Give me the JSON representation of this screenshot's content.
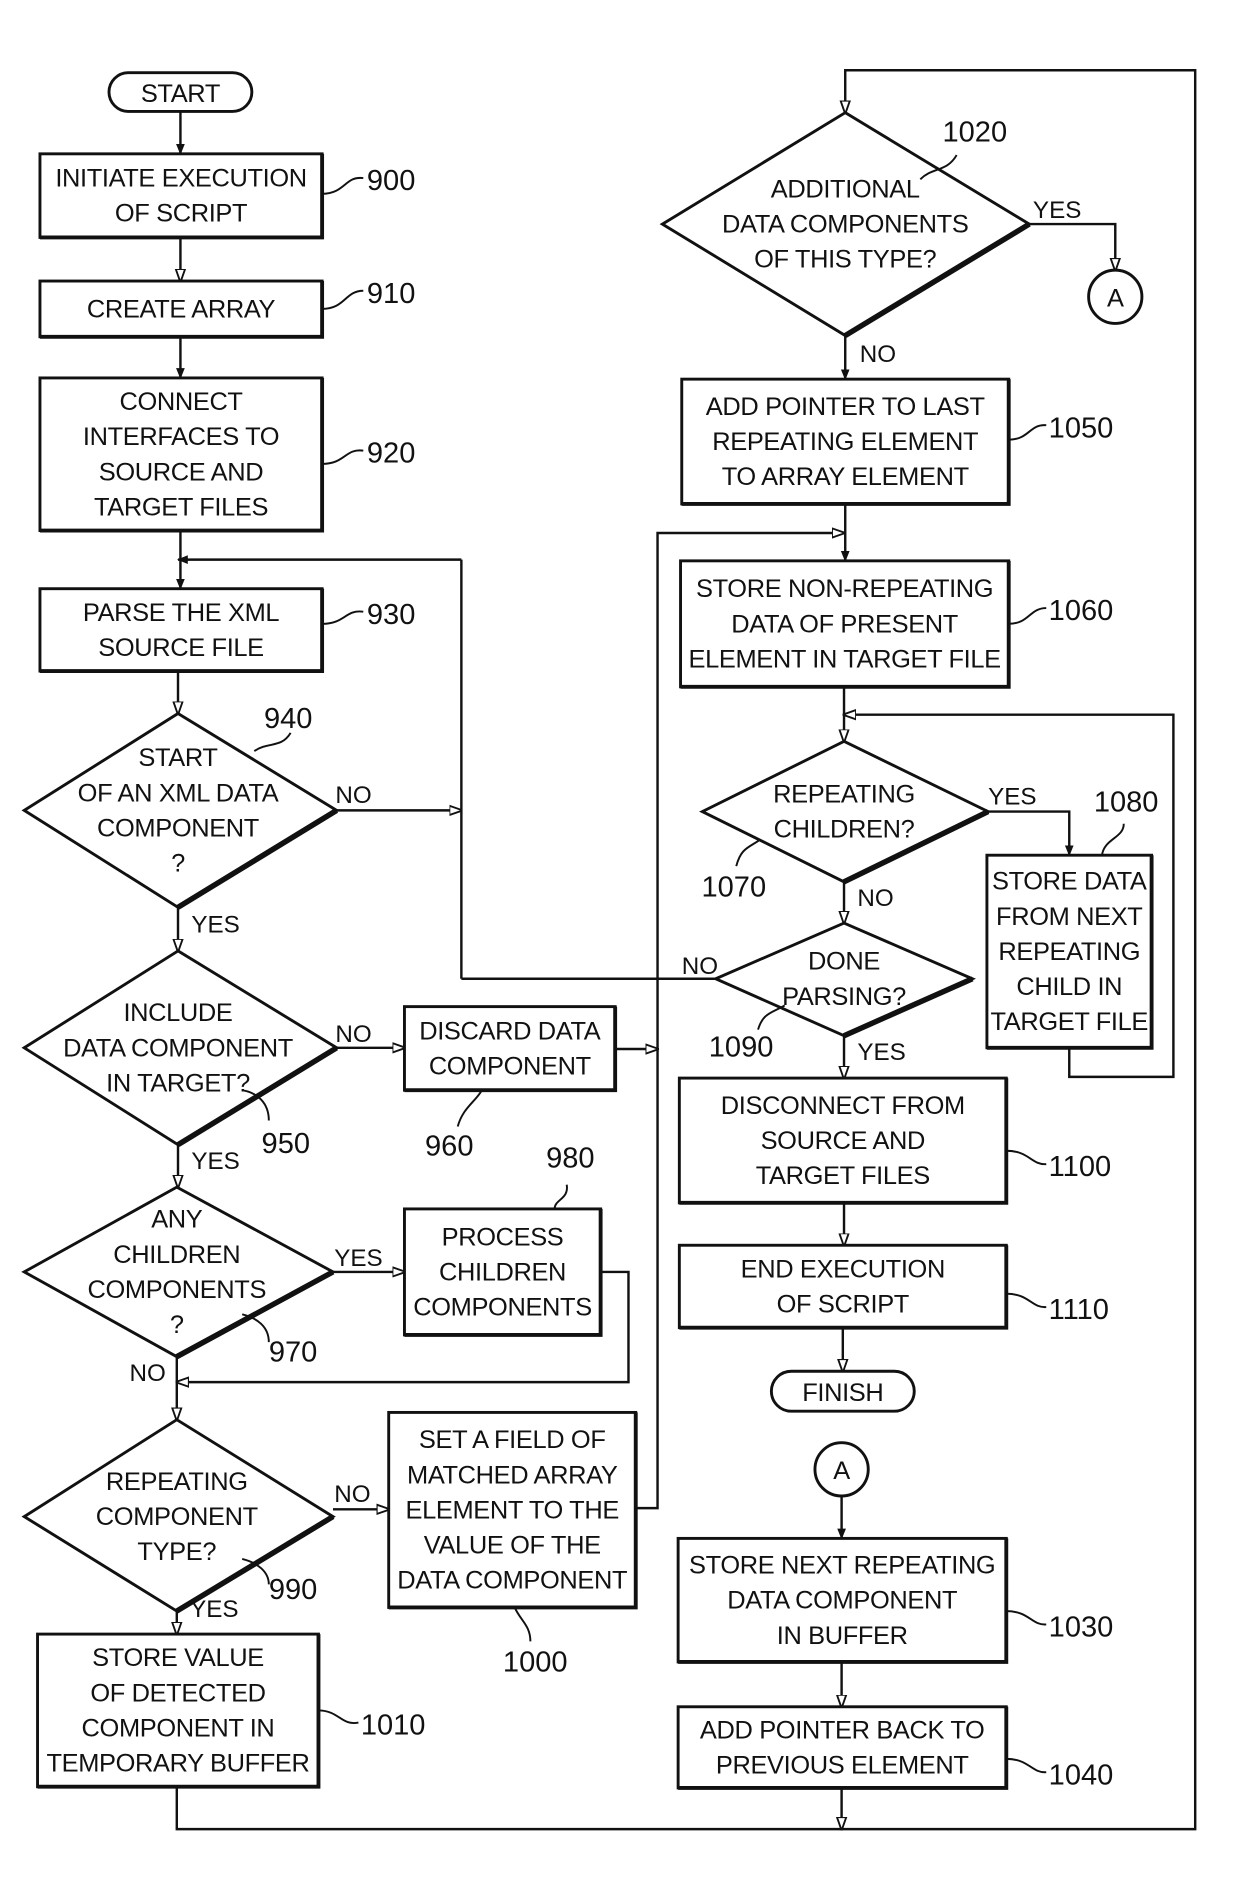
{
  "diagram": {
    "type": "flowchart",
    "colors": {
      "ink": "#111111",
      "paper": "#ffffff"
    },
    "terminals": {
      "start": "START",
      "finish": "FINISH"
    },
    "connectors": {
      "a_out": "A",
      "a_in": "A"
    },
    "nodes": {
      "n900": {
        "ref": "900",
        "shape": "process",
        "lines": [
          "INITIATE EXECUTION",
          "OF SCRIPT"
        ]
      },
      "n910": {
        "ref": "910",
        "shape": "process",
        "lines": [
          "CREATE ARRAY"
        ]
      },
      "n920": {
        "ref": "920",
        "shape": "process",
        "lines": [
          "CONNECT",
          "INTERFACES TO",
          "SOURCE AND",
          "TARGET FILES"
        ]
      },
      "n930": {
        "ref": "930",
        "shape": "process",
        "lines": [
          "PARSE THE XML",
          "SOURCE FILE"
        ]
      },
      "n940": {
        "ref": "940",
        "shape": "decision",
        "lines": [
          "START",
          "OF AN XML DATA",
          "COMPONENT",
          "?"
        ]
      },
      "n950": {
        "ref": "950",
        "shape": "decision",
        "lines": [
          "INCLUDE",
          "DATA COMPONENT",
          "IN TARGET?"
        ]
      },
      "n960": {
        "ref": "960",
        "shape": "process",
        "lines": [
          "DISCARD DATA",
          "COMPONENT"
        ]
      },
      "n970": {
        "ref": "970",
        "shape": "decision",
        "lines": [
          "ANY",
          "CHILDREN",
          "COMPONENTS",
          "?"
        ]
      },
      "n980": {
        "ref": "980",
        "shape": "process",
        "lines": [
          "PROCESS",
          "CHILDREN",
          "COMPONENTS"
        ]
      },
      "n990": {
        "ref": "990",
        "shape": "decision",
        "lines": [
          "REPEATING",
          "COMPONENT",
          "TYPE?"
        ]
      },
      "n1000": {
        "ref": "1000",
        "shape": "process",
        "lines": [
          "SET A FIELD OF",
          "MATCHED ARRAY",
          "ELEMENT TO THE",
          "VALUE OF THE",
          "DATA COMPONENT"
        ]
      },
      "n1010": {
        "ref": "1010",
        "shape": "process",
        "lines": [
          "STORE VALUE",
          "OF DETECTED",
          "COMPONENT IN",
          "TEMPORARY BUFFER"
        ]
      },
      "n1020": {
        "ref": "1020",
        "shape": "decision",
        "lines": [
          "ADDITIONAL",
          "DATA COMPONENTS",
          "OF THIS TYPE?"
        ]
      },
      "n1030": {
        "ref": "1030",
        "shape": "process",
        "lines": [
          "STORE NEXT REPEATING",
          "DATA COMPONENT",
          "IN BUFFER"
        ]
      },
      "n1040": {
        "ref": "1040",
        "shape": "process",
        "lines": [
          "ADD POINTER BACK TO",
          "PREVIOUS ELEMENT"
        ]
      },
      "n1050": {
        "ref": "1050",
        "shape": "process",
        "lines": [
          "ADD POINTER TO LAST",
          "REPEATING ELEMENT",
          "TO ARRAY ELEMENT"
        ]
      },
      "n1060": {
        "ref": "1060",
        "shape": "process",
        "lines": [
          "STORE NON-REPEATING",
          "DATA OF PRESENT",
          "ELEMENT IN TARGET FILE"
        ]
      },
      "n1070": {
        "ref": "1070",
        "shape": "decision",
        "lines": [
          "REPEATING",
          "CHILDREN?"
        ]
      },
      "n1080": {
        "ref": "1080",
        "shape": "process",
        "lines": [
          "STORE DATA",
          "FROM NEXT",
          "REPEATING",
          "CHILD IN",
          "TARGET FILE"
        ]
      },
      "n1090": {
        "ref": "1090",
        "shape": "decision",
        "lines": [
          "DONE",
          "PARSING?"
        ]
      },
      "n1100": {
        "ref": "1100",
        "shape": "process",
        "lines": [
          "DISCONNECT FROM",
          "SOURCE AND",
          "TARGET FILES"
        ]
      },
      "n1110": {
        "ref": "1110",
        "shape": "process",
        "lines": [
          "END EXECUTION",
          "OF SCRIPT"
        ]
      }
    },
    "branch_labels": {
      "n940_no": "NO",
      "n940_yes": "YES",
      "n950_no": "NO",
      "n950_yes": "YES",
      "n970_yes": "YES",
      "n970_no": "NO",
      "n990_no": "NO",
      "n990_yes": "YES",
      "n1020_yes": "YES",
      "n1020_no": "NO",
      "n1070_yes": "YES",
      "n1070_no": "NO",
      "n1090_no": "NO",
      "n1090_yes": "YES"
    },
    "edges": [
      {
        "from": "start",
        "to": "n900"
      },
      {
        "from": "n900",
        "to": "n910"
      },
      {
        "from": "n910",
        "to": "n920"
      },
      {
        "from": "n920",
        "to": "n930"
      },
      {
        "from": "n930",
        "to": "n940"
      },
      {
        "from": "n940",
        "to": "n930",
        "label": "NO"
      },
      {
        "from": "n940",
        "to": "n950",
        "label": "YES"
      },
      {
        "from": "n950",
        "to": "n960",
        "label": "NO"
      },
      {
        "from": "n950",
        "to": "n970",
        "label": "YES"
      },
      {
        "from": "n960",
        "to": "n1060"
      },
      {
        "from": "n970",
        "to": "n980",
        "label": "YES"
      },
      {
        "from": "n970",
        "to": "n990",
        "label": "NO"
      },
      {
        "from": "n980",
        "to": "n990"
      },
      {
        "from": "n990",
        "to": "n1000",
        "label": "NO"
      },
      {
        "from": "n990",
        "to": "n1010",
        "label": "YES"
      },
      {
        "from": "n1000",
        "to": "n1060"
      },
      {
        "from": "n1010",
        "to": "n1020"
      },
      {
        "from": "n1020",
        "to": "a_out",
        "label": "YES"
      },
      {
        "from": "n1020",
        "to": "n1050",
        "label": "NO"
      },
      {
        "from": "n1050",
        "to": "n1060"
      },
      {
        "from": "n1060",
        "to": "n1070"
      },
      {
        "from": "n1070",
        "to": "n1080",
        "label": "YES"
      },
      {
        "from": "n1070",
        "to": "n1090",
        "label": "NO"
      },
      {
        "from": "n1080",
        "to": "n1070"
      },
      {
        "from": "n1090",
        "to": "n930",
        "label": "NO"
      },
      {
        "from": "n1090",
        "to": "n1100",
        "label": "YES"
      },
      {
        "from": "n1100",
        "to": "n1110"
      },
      {
        "from": "n1110",
        "to": "finish"
      },
      {
        "from": "a_in",
        "to": "n1030"
      },
      {
        "from": "n1030",
        "to": "n1040"
      },
      {
        "from": "n1040",
        "to": "n1020"
      }
    ]
  }
}
